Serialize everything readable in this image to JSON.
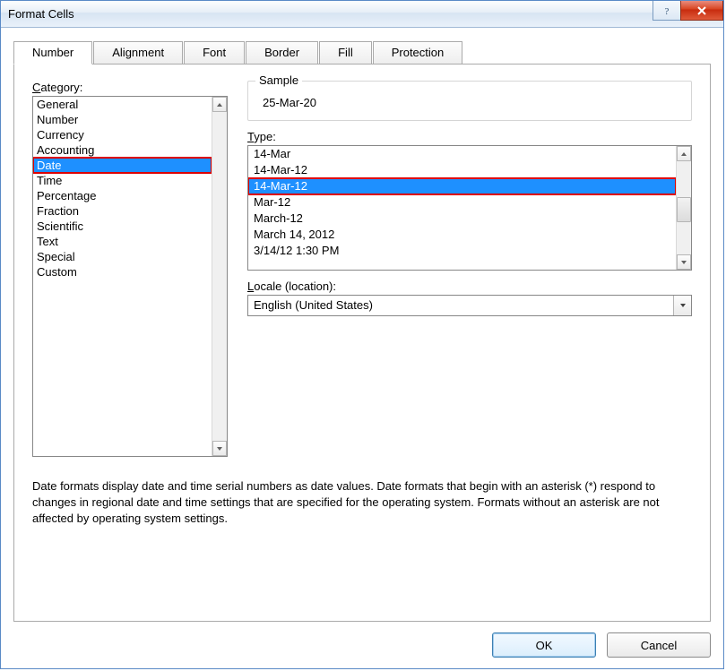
{
  "window": {
    "title": "Format Cells"
  },
  "tabs": [
    "Number",
    "Alignment",
    "Font",
    "Border",
    "Fill",
    "Protection"
  ],
  "active_tab": 0,
  "category": {
    "label_pre": "C",
    "label_rest": "ategory:",
    "items": [
      "General",
      "Number",
      "Currency",
      "Accounting",
      "Date",
      "Time",
      "Percentage",
      "Fraction",
      "Scientific",
      "Text",
      "Special",
      "Custom"
    ],
    "selected": 4
  },
  "sample": {
    "legend": "Sample",
    "value": "25-Mar-20"
  },
  "type": {
    "label_pre": "T",
    "label_rest": "ype:",
    "items": [
      "14-Mar",
      "14-Mar-12",
      "14-Mar-12",
      "Mar-12",
      "March-12",
      "March 14, 2012",
      "3/14/12 1:30 PM"
    ],
    "selected": 2
  },
  "locale": {
    "label_pre": "L",
    "label_rest": "ocale (location):",
    "value": "English (United States)"
  },
  "description": "Date formats display date and time serial numbers as date values.  Date formats that begin with an asterisk (*) respond to changes in regional date and time settings that are specified for the operating system. Formats without an asterisk are not affected by operating system settings.",
  "buttons": {
    "ok": "OK",
    "cancel": "Cancel"
  }
}
